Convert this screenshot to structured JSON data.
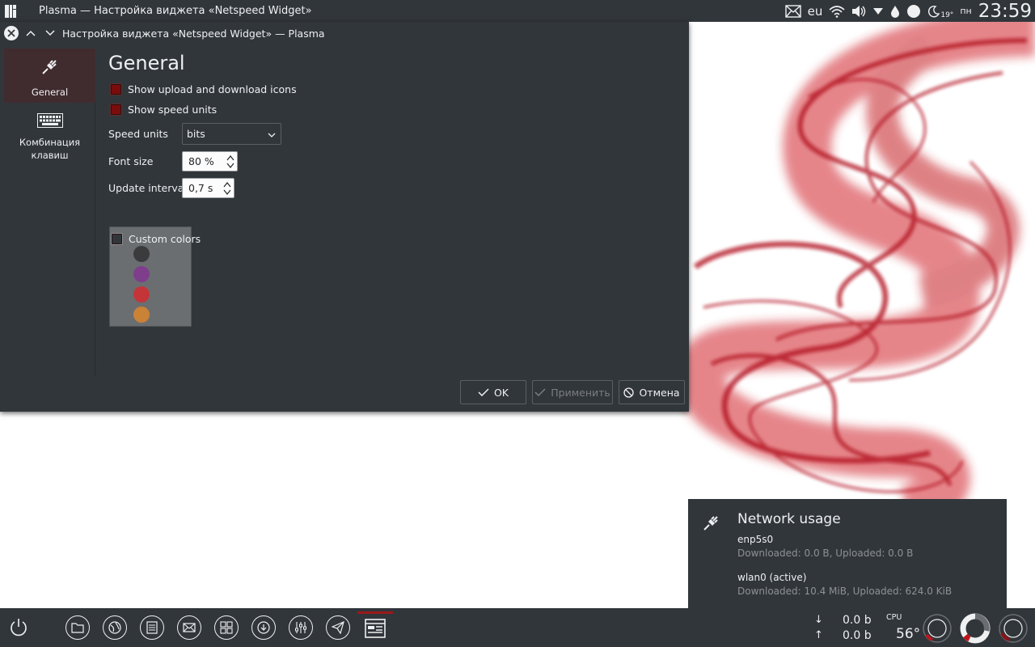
{
  "top_panel": {
    "title": "Plasma — Настройка виджета «Netspeed Widget»",
    "keyboard_layout": "eu",
    "weather_temp": "19°",
    "weekday": "пн",
    "clock": "23:59"
  },
  "dialog": {
    "title": "Настройка виджета «Netspeed Widget» — Plasma",
    "sidebar": [
      {
        "label": "General",
        "icon": "network-plug-icon",
        "active": true
      },
      {
        "label": "Комбинация клавиш",
        "icon": "keyboard-icon",
        "active": false
      }
    ],
    "page_title": "General",
    "show_icons_label": "Show upload and download icons",
    "show_units_label": "Show speed units",
    "speed_units_label": "Speed units",
    "speed_units_value": "bits",
    "font_size_label": "Font size",
    "font_size_value": "80 %",
    "update_interval_label": "Update interval",
    "update_interval_value": "0,7 s",
    "custom_colors_label": "Custom colors",
    "color_swatches": [
      "#3b3b3d",
      "#7e3e8c",
      "#c4353a",
      "#c98236"
    ],
    "buttons": {
      "ok": "OK",
      "apply": "Применить",
      "cancel": "Отмена"
    }
  },
  "network_popup": {
    "title": "Network usage",
    "interfaces": [
      {
        "name": "enp5s0",
        "stats": "Downloaded: 0.0 B, Uploaded: 0.0 B"
      },
      {
        "name": "wlan0 (active)",
        "stats": "Downloaded: 10.4 MiB, Uploaded: 624.0 KiB"
      }
    ]
  },
  "taskbar": {
    "netspeed_down": "0.0 b",
    "netspeed_up": "0.0 b",
    "down_arrow": "↓",
    "up_arrow": "↑",
    "cpu_label": "CPU",
    "cpu_temp": "56°"
  },
  "colors": {
    "panel": "#31363b",
    "accent_red": "#7a0c0c",
    "text": "#eff0f1"
  }
}
